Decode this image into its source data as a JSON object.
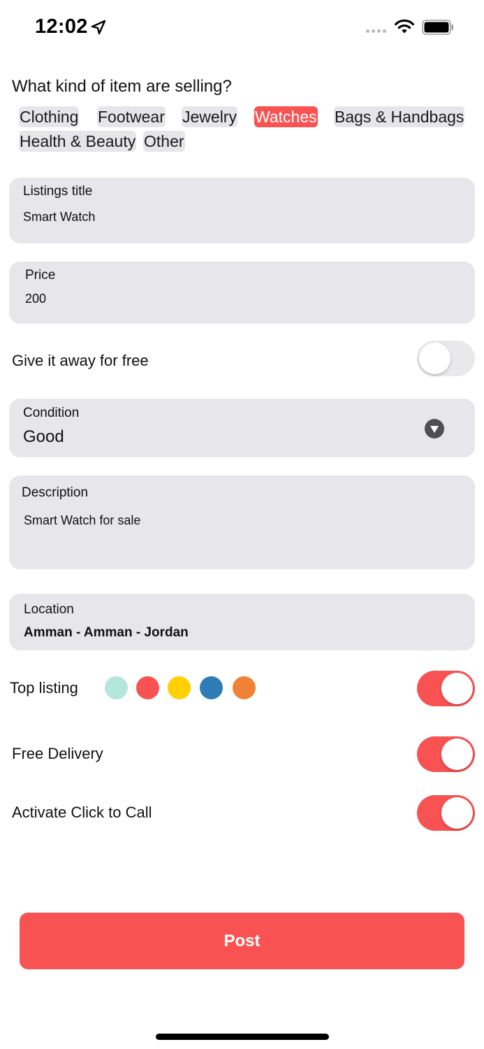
{
  "status_bar": {
    "time": "12:02",
    "icons": [
      "location-arrow-icon",
      "cellular-signal-icon",
      "wifi-icon",
      "battery-icon"
    ]
  },
  "category": {
    "question": "What kind of item are selling?",
    "chips": [
      {
        "label": "Clothing",
        "selected": false
      },
      {
        "label": "Footwear",
        "selected": false
      },
      {
        "label": "Jewelry",
        "selected": false
      },
      {
        "label": "Watches",
        "selected": true
      },
      {
        "label": "Bags & Handbags",
        "selected": false
      },
      {
        "label": "Health & Beauty",
        "selected": false
      },
      {
        "label": "Other",
        "selected": false
      }
    ]
  },
  "title_field": {
    "label": "Listings title",
    "value": "Smart Watch"
  },
  "price_field": {
    "label": "Price",
    "value": "200"
  },
  "free_toggle": {
    "label": "Give it away for free",
    "on": false
  },
  "condition_field": {
    "label": "Condition",
    "value": "Good"
  },
  "description_field": {
    "label": "Description",
    "value": "Smart Watch for sale"
  },
  "location_field": {
    "label": "Location",
    "value": "Amman - Amman - Jordan"
  },
  "top_listing": {
    "label": "Top listing",
    "on": true,
    "colors": [
      "#b4e6dc",
      "#f85252",
      "#ffd000",
      "#2e7bb6",
      "#f08236"
    ]
  },
  "free_delivery": {
    "label": "Free Delivery",
    "on": true
  },
  "click_to_call": {
    "label": "Activate Click to Call",
    "on": true
  },
  "post_button": {
    "label": "Post"
  },
  "colors": {
    "accent": "#f85252",
    "field_bg": "#e6e6eb",
    "toggle_off": "#e9e9eb"
  }
}
